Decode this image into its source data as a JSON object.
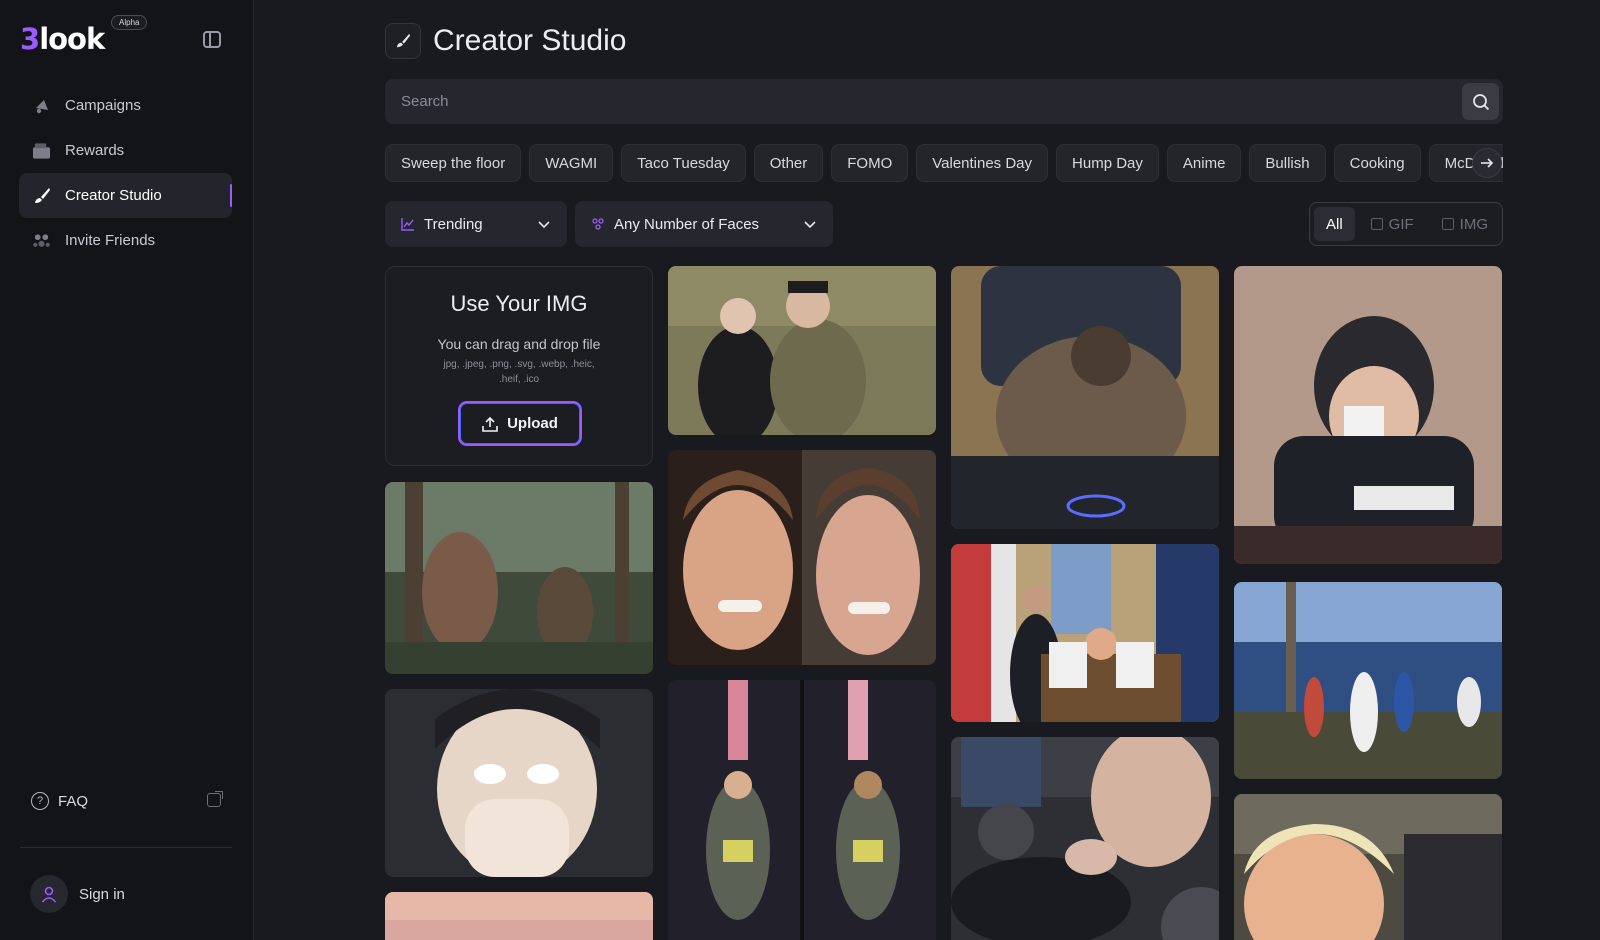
{
  "app": {
    "logo_prefix": "3",
    "logo_rest": "look",
    "badge": "Alpha"
  },
  "sidebar": {
    "items": [
      {
        "label": "Campaigns",
        "icon": "megaphone-icon"
      },
      {
        "label": "Rewards",
        "icon": "wallet-icon"
      },
      {
        "label": "Creator Studio",
        "icon": "brush-icon",
        "active": true
      },
      {
        "label": "Invite Friends",
        "icon": "people-icon"
      }
    ],
    "faq_label": "FAQ",
    "signin_label": "Sign in"
  },
  "header": {
    "title": "Creator Studio"
  },
  "search": {
    "placeholder": "Search",
    "value": ""
  },
  "tags": [
    "Sweep the floor",
    "WAGMI",
    "Taco Tuesday",
    "Other",
    "FOMO",
    "Valentines Day",
    "Hump Day",
    "Anime",
    "Bullish",
    "Cooking",
    "McDonalds"
  ],
  "filters": {
    "sort_label": "Trending",
    "faces_label": "Any Number of Faces"
  },
  "type_toggle": {
    "all": "All",
    "gif": "GIF",
    "img": "IMG",
    "selected": "All"
  },
  "upload_card": {
    "title": "Use Your IMG",
    "subtitle": "You can drag and drop file",
    "formats": "jpg, .jpeg, .png, .svg, .webp, .heic, .heif, .ico",
    "button_label": "Upload"
  },
  "colors": {
    "accent": "#9a5cff",
    "background": "#191a1f",
    "sidebar": "#131418"
  }
}
